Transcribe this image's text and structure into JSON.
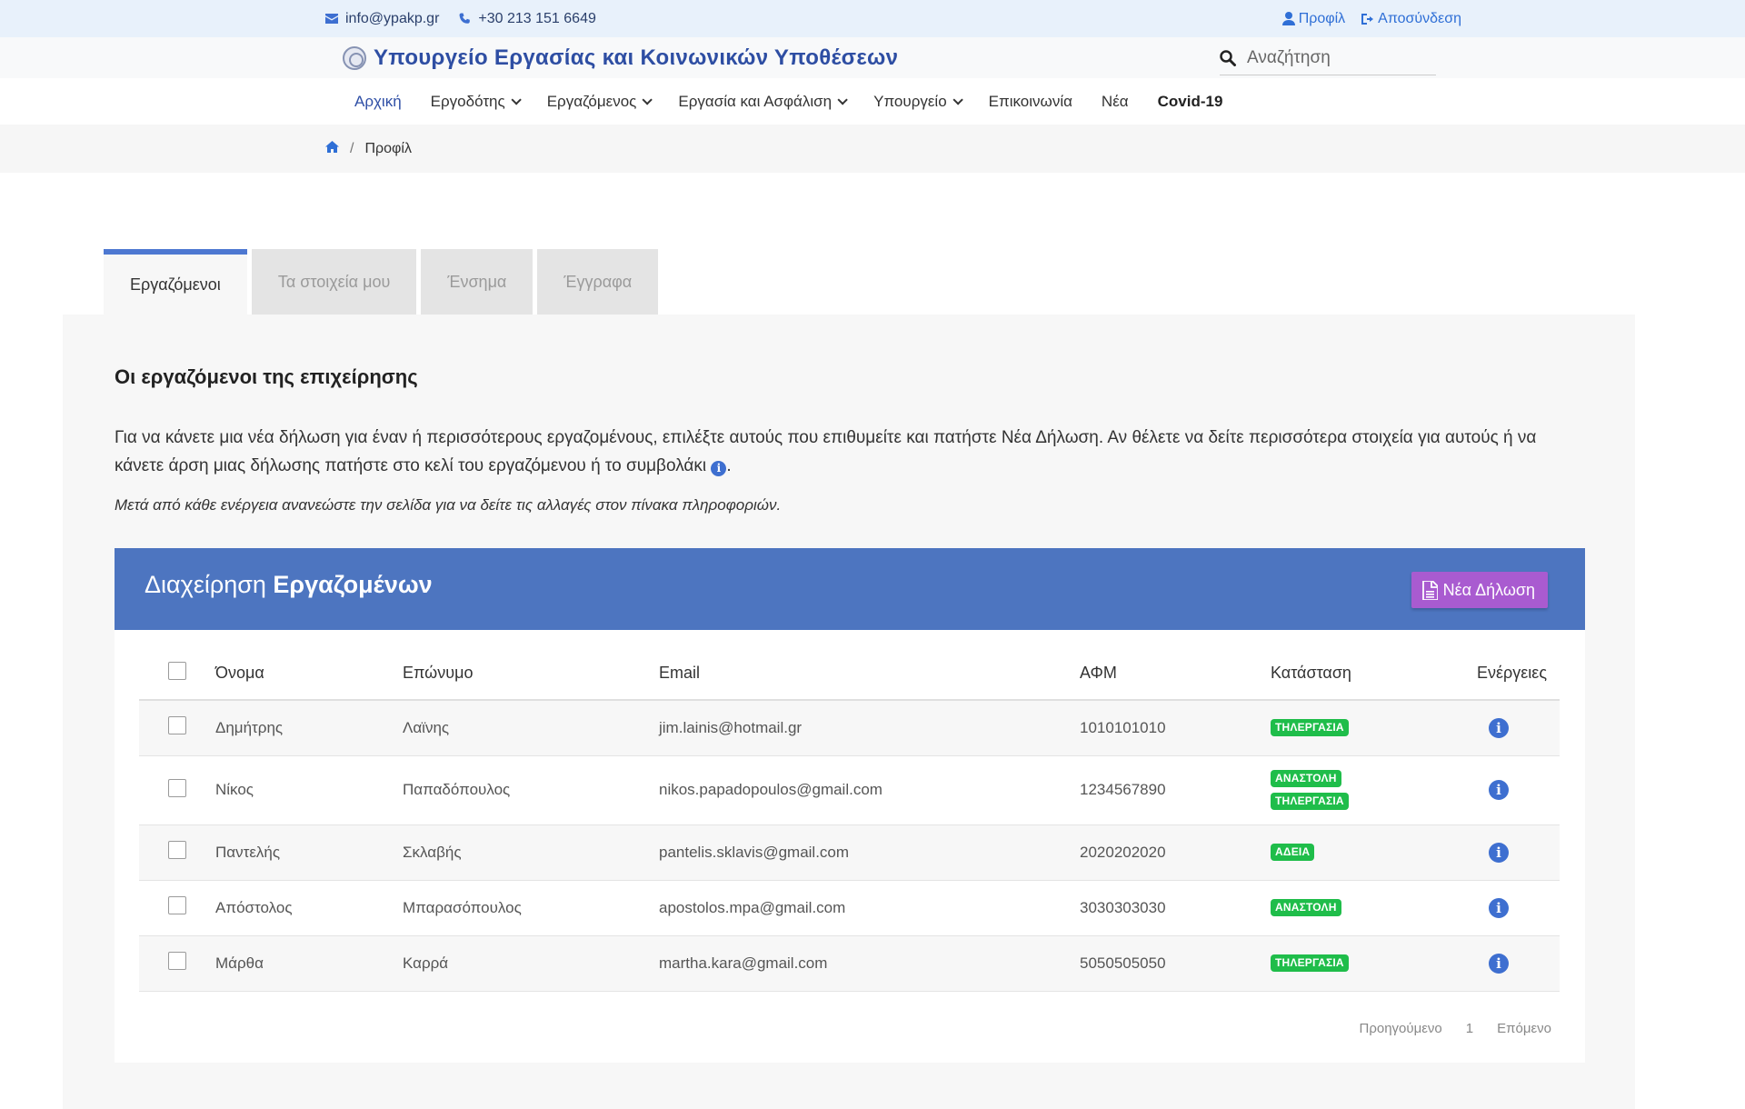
{
  "topbar": {
    "email": "info@ypakp.gr",
    "phone": "+30 213 151 6649",
    "profile_label": "Προφίλ",
    "logout_label": "Αποσύνδεση"
  },
  "header": {
    "title": "Υπουργείο Εργασίας και Κοινωνικών Υποθέσεων",
    "search_placeholder": "Αναζήτηση"
  },
  "nav": {
    "items": [
      {
        "label": "Αρχική"
      },
      {
        "label": "Εργοδότης"
      },
      {
        "label": "Εργαζόμενος"
      },
      {
        "label": "Εργασία και Ασφάλιση"
      },
      {
        "label": "Υπουργείο"
      },
      {
        "label": "Επικοινωνία"
      },
      {
        "label": "Νέα"
      },
      {
        "label": "Covid-19"
      }
    ]
  },
  "breadcrumb": {
    "current": "Προφίλ"
  },
  "tabs": [
    {
      "label": "Εργαζόμενοι"
    },
    {
      "label": "Τα στοιχεία μου"
    },
    {
      "label": "Ένσημα"
    },
    {
      "label": "Έγγραφα"
    }
  ],
  "main": {
    "heading": "Οι εργαζόμενοι της επιχείρησης",
    "intro": "Για να κάνετε μια νέα δήλωση για έναν ή περισσότερους εργαζομένους, επιλέξτε αυτούς που επιθυμείτε και πατήστε Νέα Δήλωση. Αν θέλετε να δείτε περισσότερα στοιχεία για αυτούς ή να κάνετε άρση μιας δήλωσης πατήστε στο κελί του εργαζόμενου ή το συμβολάκι",
    "intro_end": ".",
    "note": "Μετά από κάθε ενέργεια ανανεώστε την σελίδα για να δείτε τις αλλαγές στον πίνακα πληροφοριών."
  },
  "card": {
    "title_light": "Διαχείρηση",
    "title_bold": "Εργαζομένων",
    "new_button": "Νέα Δήλωση"
  },
  "table": {
    "headers": {
      "first": "Όνομα",
      "last": "Επώνυμο",
      "email": "Email",
      "afm": "ΑΦΜ",
      "status": "Κατάσταση",
      "actions": "Ενέργειες"
    },
    "rows": [
      {
        "first": "Δημήτρης",
        "last": "Λαϊνης",
        "email": "jim.lainis@hotmail.gr",
        "afm": "1010101010",
        "status": [
          "ΤΗΛΕΡΓΑΣΙΑ"
        ]
      },
      {
        "first": "Νίκος",
        "last": "Παπαδόπουλος",
        "email": "nikos.papadopoulos@gmail.com",
        "afm": "1234567890",
        "status": [
          "ΑΝΑΣΤΟΛΗ",
          "ΤΗΛΕΡΓΑΣΙΑ"
        ]
      },
      {
        "first": "Παντελής",
        "last": "Σκλαβής",
        "email": "pantelis.sklavis@gmail.com",
        "afm": "2020202020",
        "status": [
          "ΑΔΕΙΑ"
        ]
      },
      {
        "first": "Απόστολος",
        "last": "Μπαρασόπουλος",
        "email": "apostolos.mpa@gmail.com",
        "afm": "3030303030",
        "status": [
          "ΑΝΑΣΤΟΛΗ"
        ]
      },
      {
        "first": "Μάρθα",
        "last": "Καρρά",
        "email": "martha.kara@gmail.com",
        "afm": "5050505050",
        "status": [
          "ΤΗΛΕΡΓΑΣΙΑ"
        ]
      }
    ]
  },
  "pager": {
    "prev": "Προηγούμενο",
    "page": "1",
    "next": "Επόμενο"
  },
  "colors": {
    "accent": "#4d75c0",
    "button": "#a95bd0",
    "badge": "#1fbd4a",
    "info": "#3e6fd0"
  }
}
